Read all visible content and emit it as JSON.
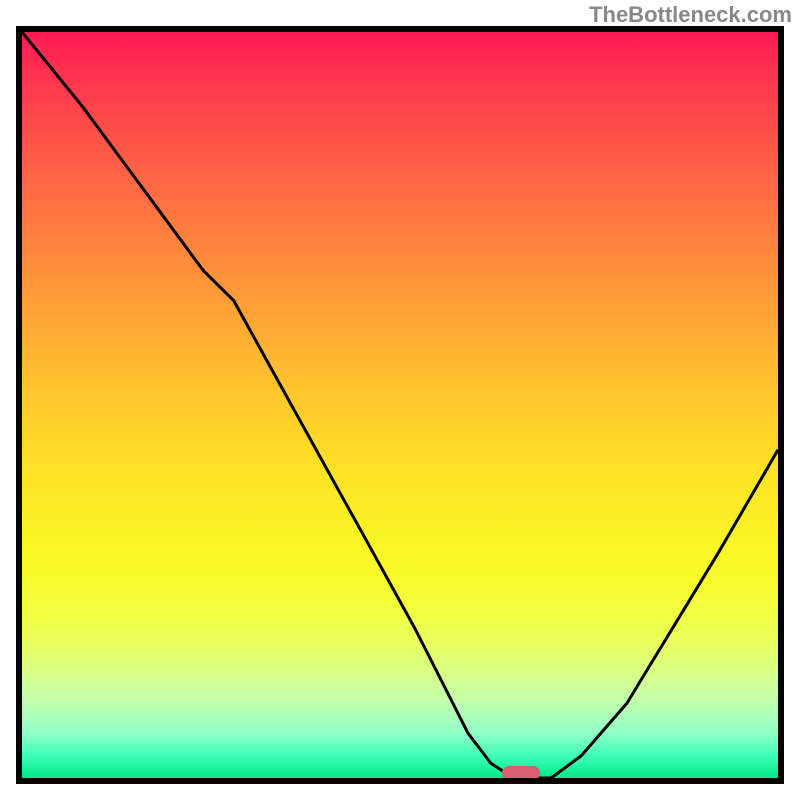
{
  "watermark": "TheBottleneck.com",
  "chart_data": {
    "type": "line",
    "title": "",
    "xlabel": "",
    "ylabel": "",
    "x": [
      0.0,
      0.08,
      0.16,
      0.24,
      0.28,
      0.34,
      0.4,
      0.46,
      0.52,
      0.56,
      0.59,
      0.62,
      0.65,
      0.7,
      0.74,
      0.8,
      0.86,
      0.92,
      0.96,
      1.0
    ],
    "values": [
      1.0,
      0.9,
      0.79,
      0.68,
      0.64,
      0.53,
      0.42,
      0.31,
      0.2,
      0.12,
      0.06,
      0.02,
      0.0,
      0.0,
      0.03,
      0.1,
      0.2,
      0.3,
      0.37,
      0.44
    ],
    "xlim": [
      0,
      1
    ],
    "ylim": [
      0,
      1
    ],
    "marker": {
      "x": 0.66,
      "y": 0.0
    },
    "gradient_colors": {
      "top": "#ff1a55",
      "mid_upper": "#ff9a38",
      "mid": "#ffd828",
      "mid_lower": "#f8fb2a",
      "bottom": "#00e888"
    }
  }
}
